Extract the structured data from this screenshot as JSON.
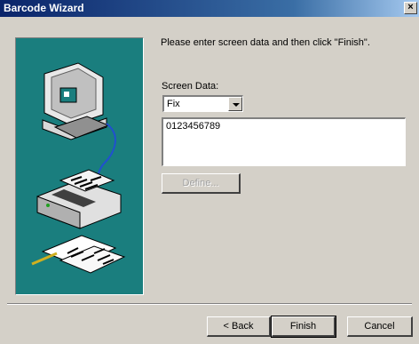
{
  "window": {
    "title": "Barcode Wizard",
    "close_glyph": "×"
  },
  "main": {
    "instruction": "Please enter screen data and then click \"Finish\".",
    "screen_data_label": "Screen Data:",
    "screen_data_type": "Fix",
    "screen_data_value": "0123456789",
    "define_label": "Define..."
  },
  "footer": {
    "back_label": "< Back",
    "finish_label": "Finish",
    "cancel_label": "Cancel"
  },
  "illustration": {
    "icons": [
      "computer-icon",
      "printer-icon",
      "barcode-labels-icon"
    ]
  },
  "colors": {
    "panel": "#1a7e7e",
    "face": "#d4d0c8",
    "titlebar": "#0a246a"
  }
}
